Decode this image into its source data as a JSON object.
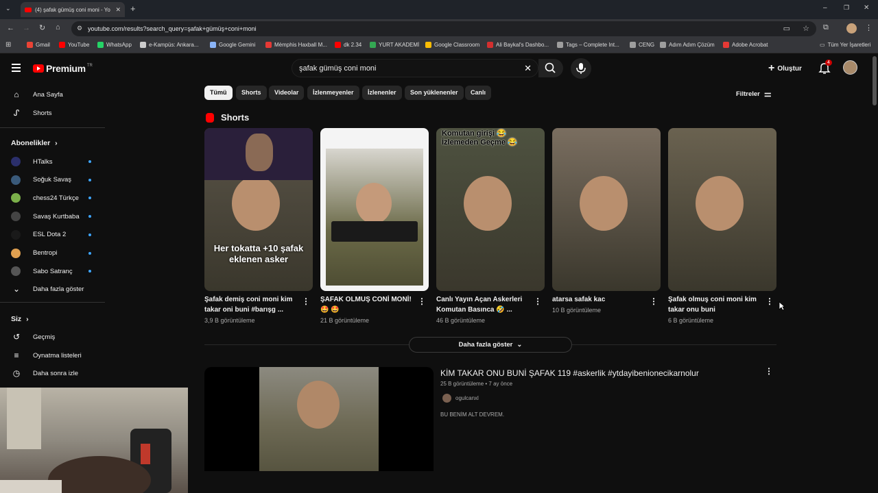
{
  "browser": {
    "tab_title": "(4) şafak gümüş coni moni - Yo",
    "url": "youtube.com/results?search_query=şafak+gümüş+coni+moni",
    "bookmarks": [
      {
        "label": "Gmail",
        "color": "#ea4335"
      },
      {
        "label": "YouTube",
        "color": "#ff0000"
      },
      {
        "label": "WhatsApp",
        "color": "#25d366"
      },
      {
        "label": "e-Kampüs: Ankara...",
        "color": "#cccccc"
      },
      {
        "label": "Google Gemini",
        "color": "#8ab4f8"
      },
      {
        "label": "Mèmphis Haxball M...",
        "color": "#e53935"
      },
      {
        "label": "dk 2.34",
        "color": "#ff0000"
      },
      {
        "label": "YURT AKADEMİ",
        "color": "#34a853"
      },
      {
        "label": "Google Classroom",
        "color": "#fbbc04"
      },
      {
        "label": "Ali Baykal's Dashbo...",
        "color": "#d32f2f"
      },
      {
        "label": "Tags – Complete Int...",
        "color": "#9e9e9e"
      },
      {
        "label": "CENG",
        "color": "#9e9e9e"
      },
      {
        "label": "Adım Adım Çözüm",
        "color": "#9e9e9e"
      },
      {
        "label": "Adobe Acrobat",
        "color": "#e53935"
      }
    ],
    "all_bookmarks": "Tüm Yer İşaretleri"
  },
  "header": {
    "logo": "Premium",
    "logo_country": "TR",
    "search_value": "şafak gümüş coni moni",
    "create_label": "Oluştur",
    "notification_count": "4"
  },
  "sidebar": {
    "home": "Ana Sayfa",
    "shorts": "Shorts",
    "subscriptions_title": "Abonelikler",
    "subscriptions": [
      {
        "label": "HTalks",
        "color": "#2b2f6b"
      },
      {
        "label": "Soğuk Savaş",
        "color": "#3a5a7a"
      },
      {
        "label": "chess24 Türkçe",
        "color": "#7bb04a"
      },
      {
        "label": "Savaş Kurtbaba",
        "color": "#444444"
      },
      {
        "label": "ESL Dota 2",
        "color": "#1a1a1a"
      },
      {
        "label": "Bentropi",
        "color": "#e0a050"
      },
      {
        "label": "Sabo Satranç",
        "color": "#555555"
      }
    ],
    "show_more": "Daha fazla göster",
    "you_title": "Siz",
    "history": "Geçmiş",
    "playlists": "Oynatma listeleri",
    "watch_later": "Daha sonra izle"
  },
  "chips": [
    "Tümü",
    "Shorts",
    "Videolar",
    "İzlenmeyenler",
    "İzlenenler",
    "Son yüklenenler",
    "Canlı"
  ],
  "filters_label": "Filtreler",
  "shorts_section": {
    "title": "Shorts",
    "items": [
      {
        "title": "Şafak demiş coni moni kim takar oni buni #barışg ...",
        "views": "3,9 B görüntüleme",
        "overlay": "Her tokatta +10 şafak eklenen asker",
        "bg": "#5a5448"
      },
      {
        "title": "ŞAFAK OLMUŞ CONİ MONİ! 🤩 🤩",
        "views": "21 B görüntüleme",
        "overlay": "",
        "bg": "#6b6450"
      },
      {
        "title": "Canlı Yayın Açan Askerleri Komutan Basınca 🤣 ...",
        "views": "46 B görüntüleme",
        "overlay": "Komutan girişi 😂 İzlemeden Geçme 😂",
        "bg": "#4e5240"
      },
      {
        "title": "atarsa safak kac",
        "views": "10 B görüntüleme",
        "overlay": "",
        "bg": "#7a6e60"
      },
      {
        "title": "Şafak olmuş coni moni kim takar onu buni",
        "views": "6 B görüntüleme",
        "overlay": "",
        "bg": "#6a6250"
      }
    ],
    "show_more": "Daha fazla göster"
  },
  "video_result": {
    "title": "KİM TAKAR ONU BUNİ ŞAFAK 119 #askerlik #ytdayibenionecikarnolur",
    "meta": "25 B görüntüleme • 7 ay önce",
    "channel": "ogulcanxl",
    "description": "BU BENİM ALT DEVREM."
  }
}
